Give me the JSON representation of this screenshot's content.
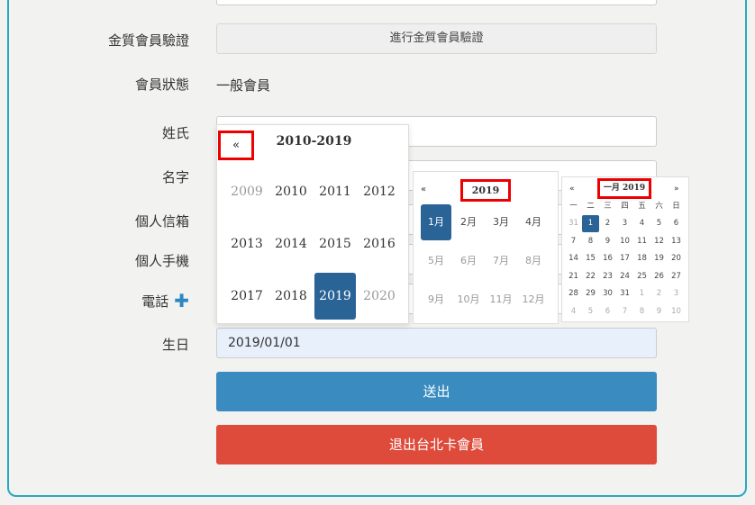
{
  "form": {
    "gold_verify_label": "金質會員驗證",
    "gold_verify_button": "進行金質會員驗證",
    "status_label": "會員狀態",
    "status_value": "一般會員",
    "last_name_label": "姓氏",
    "first_name_label": "名字",
    "email_label": "個人信箱",
    "mobile_label": "個人手機",
    "phone_label": "電話",
    "phone_add_icon": "plus-icon",
    "birthday_label": "生日",
    "birthday_value": "2019/01/01",
    "submit_button": "送出",
    "quit_button": "退出台北卡會員"
  },
  "decade_picker": {
    "prev": "«",
    "title": "2010-2019",
    "years": [
      "2009",
      "2010",
      "2011",
      "2012",
      "2013",
      "2014",
      "2015",
      "2016",
      "2017",
      "2018",
      "2019",
      "2020"
    ],
    "muted": [
      "2009",
      "2020"
    ],
    "selected": "2019"
  },
  "month_picker": {
    "prev": "«",
    "title": "2019",
    "months": [
      "1月",
      "2月",
      "3月",
      "4月",
      "5月",
      "6月",
      "7月",
      "8月",
      "9月",
      "10月",
      "11月",
      "12月"
    ],
    "selected": "1月"
  },
  "day_picker": {
    "prev": "«",
    "next": "»",
    "title": "一月 2019",
    "weekdays": [
      "一",
      "二",
      "三",
      "四",
      "五",
      "六",
      "日"
    ],
    "days": [
      [
        "31",
        "1",
        "2",
        "3",
        "4",
        "5",
        "6"
      ],
      [
        "7",
        "8",
        "9",
        "10",
        "11",
        "12",
        "13"
      ],
      [
        "14",
        "15",
        "16",
        "17",
        "18",
        "19",
        "20"
      ],
      [
        "21",
        "22",
        "23",
        "24",
        "25",
        "26",
        "27"
      ],
      [
        "28",
        "29",
        "30",
        "31",
        "1",
        "2",
        "3"
      ],
      [
        "4",
        "5",
        "6",
        "7",
        "8",
        "9",
        "10"
      ]
    ],
    "selected_day": "1"
  },
  "colors": {
    "accent_blue": "#3a8bc0",
    "selected_blue": "#2a6496",
    "danger_red": "#df4b3b",
    "highlight_red": "#e00000",
    "panel_border": "#2aa7c0"
  }
}
